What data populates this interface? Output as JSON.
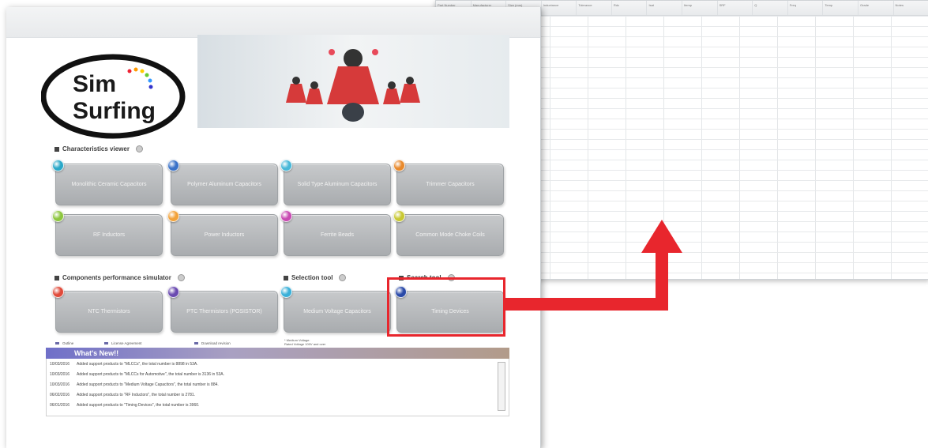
{
  "spreadsheet": {
    "columns": [
      "Part Number",
      "Manufacturer",
      "Size (mm)",
      "Inductance",
      "Tolerance",
      "Rdc",
      "Isat",
      "Itemp",
      "SRF",
      "Q",
      "Freq",
      "Temp",
      "Grade",
      "Notes"
    ]
  },
  "app": {
    "logo_line1": "Sim",
    "logo_line2": "Surfing"
  },
  "characteristics_viewer": {
    "title": "Characteristics viewer",
    "tiles": [
      {
        "label": "Monolithic Ceramic Capacitors",
        "dot_color": "#2aa8c8"
      },
      {
        "label": "Polymer Aluminum Capacitors",
        "dot_color": "#3a72c8"
      },
      {
        "label": "Solid Type Aluminum Capacitors",
        "dot_color": "#49b8d8"
      },
      {
        "label": "Trimmer Capacitors",
        "dot_color": "#e8892c"
      },
      {
        "label": "RF Inductors",
        "dot_color": "#8dc63f"
      },
      {
        "label": "Power Inductors",
        "dot_color": "#f2a23a"
      },
      {
        "label": "Ferrite Beads",
        "dot_color": "#c84ab2"
      },
      {
        "label": "Common Mode Choke Coils",
        "dot_color": "#c8c832"
      }
    ]
  },
  "simulator": {
    "title": "Components performance simulator",
    "tiles": [
      {
        "label": "NTC Thermistors",
        "dot_color": "#e04a3a"
      },
      {
        "label": "PTC Thermistors (POSISTOR)",
        "dot_color": "#6a4ab0"
      }
    ]
  },
  "selection_tool": {
    "title": "Selection tool",
    "tiles": [
      {
        "label": "Medium Voltage Capacitors",
        "dot_color": "#3ab0d8"
      }
    ],
    "note_line1": "* Medium Voltage:",
    "note_line2": "Rated Voltage 100V and over"
  },
  "search_tool": {
    "title": "Search tool",
    "tiles": [
      {
        "label": "Timing Devices",
        "dot_color": "#2a4aa8"
      }
    ]
  },
  "links": [
    "Outline",
    "License Agreement",
    "Download revision"
  ],
  "news": {
    "header": "What's New!!",
    "items": [
      {
        "date": "10/03/2016",
        "text": "Added support products to \"MLCCs\", the total number is 8898 in 53A."
      },
      {
        "date": "10/03/2016",
        "text": "Added support products to \"MLCCs for Automotive\", the total number is 3136 in 53A."
      },
      {
        "date": "10/03/2016",
        "text": "Added support products to \"Medium Voltage Capacitors\", the total number is 884."
      },
      {
        "date": "06/02/2016",
        "text": "Added support products to \"RF Inductors\", the total number is 2781."
      },
      {
        "date": "06/01/2016",
        "text": "Added support products to \"Timing Devices\", the total number is 3960."
      }
    ]
  },
  "annotation": {
    "highlight_color": "#e8262d"
  }
}
